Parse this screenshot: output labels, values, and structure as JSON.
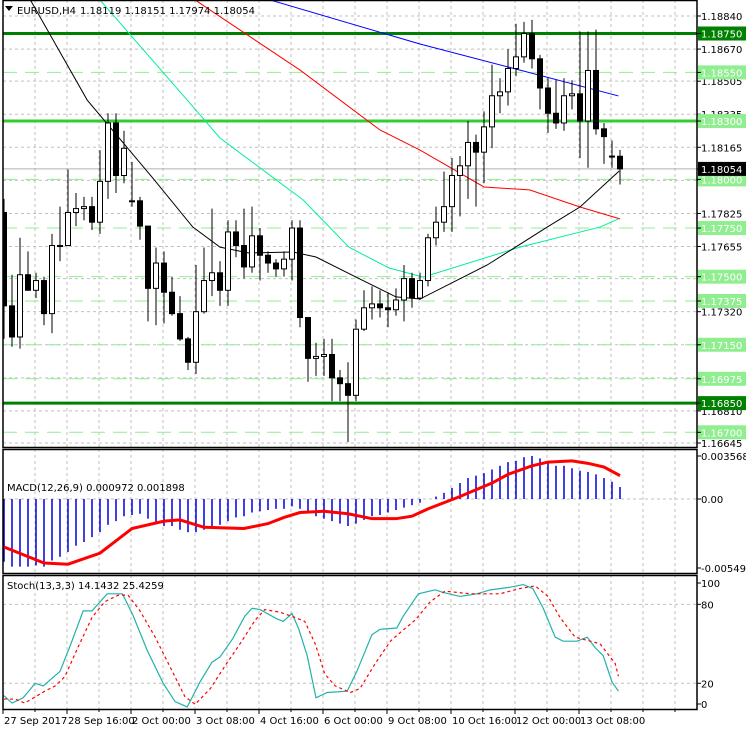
{
  "header": {
    "menu_icon": "triangle-down-icon",
    "symbol": "EURUSD,H4",
    "ohlc": "1.18119 1.18151 1.17974 1.18054"
  },
  "colors": {
    "bull": "#ffffff",
    "bear": "#000000",
    "ma_blue": "#0000ff",
    "ma_red": "#ff0000",
    "ma_cyan": "#00ee99",
    "ma_black": "#000000",
    "level_strong": "#008000",
    "level_mid": "#32cd32",
    "level_dashed": "#90ee90",
    "macd_hist": "#0000dd",
    "macd_signal": "#ff0000",
    "stoch_main": "#20b2aa",
    "stoch_signal": "#ff0000",
    "grid": "#c0c0c0"
  },
  "price_axis": {
    "ticks": [
      "1.18840",
      "1.18670",
      "1.18505",
      "1.18335",
      "1.18165",
      "1.17995",
      "1.17825",
      "1.17655",
      "1.17490",
      "1.17320",
      "1.17150",
      "1.16980",
      "1.16810",
      "1.16645"
    ],
    "visible_tick_labels": [
      "1.18840",
      "1.18670",
      "1.18505",
      "1.18165",
      "1.17825",
      "1.17655",
      "1.17320",
      "1.16810",
      "1.16645"
    ],
    "current_price": "1.18054"
  },
  "levels": [
    {
      "price": "1.18750",
      "style": "solid",
      "strength": "strong"
    },
    {
      "price": "1.18550",
      "style": "dashed"
    },
    {
      "price": "1.18300",
      "style": "solid",
      "strength": "mid"
    },
    {
      "price": "1.18000",
      "style": "dashed"
    },
    {
      "price": "1.17750",
      "style": "dashed"
    },
    {
      "price": "1.17500",
      "style": "dashed"
    },
    {
      "price": "1.17375",
      "style": "dashed"
    },
    {
      "price": "1.17150",
      "style": "dashed"
    },
    {
      "price": "1.16975",
      "style": "dashed"
    },
    {
      "price": "1.16850",
      "style": "solid",
      "strength": "strong"
    },
    {
      "price": "1.16700",
      "style": "dashed"
    }
  ],
  "candles": [
    [
      1.1783,
      1.179,
      1.1718,
      1.1735
    ],
    [
      1.1735,
      1.1751,
      1.1714,
      1.1719
    ],
    [
      1.1719,
      1.177,
      1.1713,
      1.1751
    ],
    [
      1.1751,
      1.1763,
      1.1743,
      1.1743
    ],
    [
      1.1743,
      1.1752,
      1.1739,
      1.1748
    ],
    [
      1.1748,
      1.175,
      1.1725,
      1.1731
    ],
    [
      1.1731,
      1.1772,
      1.1721,
      1.1766
    ],
    [
      1.1766,
      1.1786,
      1.1758,
      1.1766
    ],
    [
      1.1766,
      1.1805,
      1.1766,
      1.1783
    ],
    [
      1.1783,
      1.1793,
      1.1776,
      1.1785
    ],
    [
      1.1785,
      1.1791,
      1.1779,
      1.1786
    ],
    [
      1.1786,
      1.1791,
      1.1774,
      1.1778
    ],
    [
      1.1778,
      1.1815,
      1.1772,
      1.1799
    ],
    [
      1.1799,
      1.1834,
      1.179,
      1.1829
    ],
    [
      1.1829,
      1.1834,
      1.1793,
      1.1802
    ],
    [
      1.1802,
      1.1825,
      1.1798,
      1.1816
    ],
    [
      1.1789,
      1.1809,
      1.1786,
      1.1789
    ],
    [
      1.1789,
      1.1791,
      1.1769,
      1.1776
    ],
    [
      1.1776,
      1.1776,
      1.1727,
      1.1744
    ],
    [
      1.1744,
      1.1765,
      1.1725,
      1.1757
    ],
    [
      1.1757,
      1.1763,
      1.1726,
      1.1742
    ],
    [
      1.1742,
      1.175,
      1.173,
      1.1731
    ],
    [
      1.1731,
      1.174,
      1.1717,
      1.1718
    ],
    [
      1.1718,
      1.1719,
      1.1702,
      1.1706
    ],
    [
      1.1706,
      1.1756,
      1.17,
      1.1732
    ],
    [
      1.1732,
      1.1765,
      1.1731,
      1.1748
    ],
    [
      1.1748,
      1.1785,
      1.174,
      1.1752
    ],
    [
      1.1752,
      1.1758,
      1.1735,
      1.1743
    ],
    [
      1.1743,
      1.1779,
      1.1735,
      1.1773
    ],
    [
      1.1773,
      1.1779,
      1.176,
      1.1766
    ],
    [
      1.1766,
      1.1785,
      1.1749,
      1.1755
    ],
    [
      1.1755,
      1.1786,
      1.1752,
      1.1771
    ],
    [
      1.1771,
      1.1775,
      1.1748,
      1.1761
    ],
    [
      1.1761,
      1.1763,
      1.1752,
      1.1757
    ],
    [
      1.1757,
      1.1759,
      1.175,
      1.1754
    ],
    [
      1.1754,
      1.1763,
      1.175,
      1.1759
    ],
    [
      1.1759,
      1.1779,
      1.1748,
      1.1775
    ],
    [
      1.1775,
      1.1779,
      1.1724,
      1.1729
    ],
    [
      1.1729,
      1.1729,
      1.1696,
      1.1708
    ],
    [
      1.1708,
      1.1716,
      1.1699,
      1.1709
    ],
    [
      1.1709,
      1.1718,
      1.1699,
      1.171
    ],
    [
      1.171,
      1.1718,
      1.1686,
      1.1698
    ],
    [
      1.1698,
      1.1702,
      1.1686,
      1.1695
    ],
    [
      1.1695,
      1.1706,
      1.1665,
      1.1689
    ],
    [
      1.1689,
      1.1728,
      1.1686,
      1.1723
    ],
    [
      1.1723,
      1.1743,
      1.1722,
      1.1734
    ],
    [
      1.1734,
      1.1745,
      1.1728,
      1.1736
    ],
    [
      1.1736,
      1.1743,
      1.1729,
      1.1734
    ],
    [
      1.1734,
      1.1742,
      1.1724,
      1.1733
    ],
    [
      1.1733,
      1.1744,
      1.173,
      1.1738
    ],
    [
      1.1738,
      1.1756,
      1.1727,
      1.1749
    ],
    [
      1.1749,
      1.1752,
      1.1734,
      1.1739
    ],
    [
      1.1739,
      1.1752,
      1.1738,
      1.1748
    ],
    [
      1.1748,
      1.1772,
      1.1745,
      1.177
    ],
    [
      1.177,
      1.1786,
      1.1766,
      1.1778
    ],
    [
      1.1778,
      1.1804,
      1.1773,
      1.1786
    ],
    [
      1.1786,
      1.1811,
      1.1773,
      1.1802
    ],
    [
      1.1802,
      1.1812,
      1.1781,
      1.1807
    ],
    [
      1.1807,
      1.183,
      1.179,
      1.1819
    ],
    [
      1.1819,
      1.1823,
      1.1786,
      1.1814
    ],
    [
      1.1814,
      1.1835,
      1.1798,
      1.1827
    ],
    [
      1.1827,
      1.1859,
      1.1816,
      1.1843
    ],
    [
      1.1843,
      1.1852,
      1.1834,
      1.1845
    ],
    [
      1.1845,
      1.1867,
      1.1838,
      1.1857
    ],
    [
      1.1857,
      1.188,
      1.1853,
      1.1863
    ],
    [
      1.1863,
      1.1881,
      1.186,
      1.1875
    ],
    [
      1.1875,
      1.1882,
      1.1857,
      1.1862
    ],
    [
      1.1862,
      1.1864,
      1.1836,
      1.1847
    ],
    [
      1.1847,
      1.1852,
      1.1824,
      1.1834
    ],
    [
      1.1834,
      1.1851,
      1.1826,
      1.1829
    ],
    [
      1.1829,
      1.1852,
      1.1825,
      1.1843
    ],
    [
      1.1843,
      1.1851,
      1.1836,
      1.1844
    ],
    [
      1.1844,
      1.1876,
      1.1811,
      1.183
    ],
    [
      1.183,
      1.1876,
      1.1806,
      1.1856
    ],
    [
      1.1856,
      1.1877,
      1.1823,
      1.1826
    ],
    [
      1.1826,
      1.1829,
      1.1808,
      1.1822
    ],
    [
      1.1812,
      1.182,
      1.1806,
      1.1812
    ],
    [
      1.18119,
      1.18151,
      1.17974,
      1.18054
    ]
  ],
  "moving_averages": [
    {
      "name": "ma_blue",
      "points": [
        [
          33.3,
          1.18922
        ],
        [
          52,
          1.18696
        ],
        [
          64.5,
          1.18562
        ],
        [
          76.8,
          1.18429
        ]
      ]
    },
    {
      "name": "ma_red",
      "points": [
        [
          23.9,
          1.18922
        ],
        [
          37,
          1.18562
        ],
        [
          47,
          1.18254
        ],
        [
          52,
          1.18151
        ],
        [
          60,
          1.17961
        ],
        [
          65.7,
          1.17946
        ],
        [
          72,
          1.17858
        ],
        [
          77,
          1.17797
        ]
      ]
    },
    {
      "name": "ma_cyan",
      "points": [
        [
          12,
          1.18922
        ],
        [
          22.9,
          1.18408
        ],
        [
          27,
          1.18213
        ],
        [
          37.4,
          1.17894
        ],
        [
          43.1,
          1.17652
        ],
        [
          48.1,
          1.17545
        ],
        [
          52.4,
          1.17498
        ],
        [
          64.5,
          1.17652
        ],
        [
          74.5,
          1.17755
        ],
        [
          76.8,
          1.17797
        ]
      ]
    },
    {
      "name": "ma_black",
      "points": [
        [
          3.3,
          1.18922
        ],
        [
          10.4,
          1.18408
        ],
        [
          18.6,
          1.18007
        ],
        [
          23.6,
          1.17755
        ],
        [
          27,
          1.17652
        ],
        [
          30.6,
          1.17622
        ],
        [
          36.1,
          1.17627
        ],
        [
          39,
          1.17601
        ],
        [
          44,
          1.17498
        ],
        [
          49,
          1.17396
        ],
        [
          52,
          1.17385
        ],
        [
          60.4,
          1.1756
        ],
        [
          67.9,
          1.17755
        ],
        [
          72,
          1.17858
        ],
        [
          76.9,
          1.18043
        ]
      ]
    }
  ],
  "macd": {
    "label": "MACD(12,26,9) 0.000972 0.001898",
    "axis_labels": [
      "0.003568",
      "0.00",
      "-0.005495"
    ],
    "histogram": [
      -0.0051,
      -0.0055,
      -0.0055,
      -0.0055,
      -0.0054,
      -0.0055,
      -0.005,
      -0.0047,
      -0.0043,
      -0.0038,
      -0.0035,
      -0.0031,
      -0.0027,
      -0.0021,
      -0.0018,
      -0.0014,
      -0.0013,
      -0.0012,
      -0.0016,
      -0.0019,
      -0.0022,
      -0.0022,
      -0.0025,
      -0.0027,
      -0.0027,
      -0.0025,
      -0.0022,
      -0.0021,
      -0.0018,
      -0.0015,
      -0.0014,
      -0.0011,
      -0.001,
      -0.0009,
      -0.0008,
      -0.0008,
      -0.0006,
      -0.0008,
      -0.0011,
      -0.0014,
      -0.0016,
      -0.0018,
      -0.002,
      -0.0022,
      -0.002,
      -0.0017,
      -0.0014,
      -0.0013,
      -0.0011,
      -0.0009,
      -0.0007,
      -0.0005,
      -0.0003,
      0.0,
      0.0002,
      0.0005,
      0.0009,
      0.0013,
      0.0017,
      0.0019,
      0.0021,
      0.0024,
      0.0027,
      0.003,
      0.0031,
      0.0034,
      0.0035,
      0.0033,
      0.003,
      0.0027,
      0.0027,
      0.0025,
      0.0023,
      0.0022,
      0.002,
      0.0017,
      0.0014,
      0.000972
    ],
    "signal": [
      [
        0,
        -0.0039
      ],
      [
        5,
        -0.0052
      ],
      [
        8,
        -0.0053
      ],
      [
        12,
        -0.0044
      ],
      [
        16,
        -0.0024
      ],
      [
        20,
        -0.0018
      ],
      [
        22,
        -0.0017
      ],
      [
        25,
        -0.0023
      ],
      [
        30,
        -0.0024
      ],
      [
        33,
        -0.002
      ],
      [
        35,
        -0.0015
      ],
      [
        37,
        -0.0011
      ],
      [
        40,
        -0.001
      ],
      [
        43,
        -0.0012
      ],
      [
        46,
        -0.0016
      ],
      [
        49,
        -0.0016
      ],
      [
        51,
        -0.0014
      ],
      [
        53,
        -0.0008
      ],
      [
        57,
        0.0002
      ],
      [
        61,
        0.0013
      ],
      [
        63,
        0.002
      ],
      [
        66,
        0.0027
      ],
      [
        68,
        0.003
      ],
      [
        71,
        0.0031
      ],
      [
        73,
        0.0029
      ],
      [
        75,
        0.0026
      ],
      [
        77,
        0.0019
      ]
    ]
  },
  "stoch": {
    "label": "Stoch(13,3,3) 14.1432 25.4259",
    "axis_labels": [
      "100",
      "80",
      "20",
      "0"
    ],
    "main": [
      [
        0,
        10.6
      ],
      [
        1,
        5
      ],
      [
        2.4,
        9
      ],
      [
        3.9,
        20
      ],
      [
        4.9,
        18
      ],
      [
        7,
        29
      ],
      [
        8.3,
        49
      ],
      [
        9.9,
        75
      ],
      [
        11,
        75
      ],
      [
        12.9,
        88
      ],
      [
        14.8,
        88
      ],
      [
        16.1,
        72
      ],
      [
        17.9,
        45
      ],
      [
        19.9,
        20
      ],
      [
        21.4,
        6
      ],
      [
        22.9,
        2
      ],
      [
        24.5,
        21
      ],
      [
        26,
        36
      ],
      [
        27,
        40
      ],
      [
        28.6,
        54
      ],
      [
        30.1,
        71
      ],
      [
        31,
        77
      ],
      [
        32,
        76
      ],
      [
        34.1,
        69
      ],
      [
        34.9,
        67
      ],
      [
        36,
        73
      ],
      [
        36.8,
        62
      ],
      [
        37.9,
        41
      ],
      [
        39,
        9
      ],
      [
        40.4,
        13
      ],
      [
        42.9,
        14
      ],
      [
        44.1,
        29
      ],
      [
        46,
        57
      ],
      [
        47,
        61
      ],
      [
        49.1,
        62
      ],
      [
        49.9,
        71
      ],
      [
        51.8,
        88
      ],
      [
        53.9,
        91
      ],
      [
        54.9,
        89
      ],
      [
        57,
        86
      ],
      [
        59.1,
        88
      ],
      [
        60.8,
        91
      ],
      [
        63.3,
        93
      ],
      [
        64.9,
        95
      ],
      [
        66.1,
        92
      ],
      [
        67.4,
        77
      ],
      [
        68.9,
        55
      ],
      [
        69.9,
        52
      ],
      [
        71.6,
        52
      ],
      [
        72.9,
        55
      ],
      [
        73.9,
        47
      ],
      [
        74.9,
        41
      ],
      [
        76,
        21
      ],
      [
        76.8,
        14.1
      ]
    ],
    "signal": [
      [
        0,
        8
      ],
      [
        1.4,
        8
      ],
      [
        2.6,
        5
      ],
      [
        5.1,
        14
      ],
      [
        6.4,
        18
      ],
      [
        7.6,
        25
      ],
      [
        9.3,
        48
      ],
      [
        11,
        70
      ],
      [
        12.6,
        82
      ],
      [
        14.3,
        87
      ],
      [
        15.5,
        87
      ],
      [
        17,
        75
      ],
      [
        18.9,
        55
      ],
      [
        20.8,
        32
      ],
      [
        22.6,
        10
      ],
      [
        23.9,
        4
      ],
      [
        25.8,
        16
      ],
      [
        27.6,
        33
      ],
      [
        29.5,
        50
      ],
      [
        31.4,
        68
      ],
      [
        32.6,
        76
      ],
      [
        34.5,
        74
      ],
      [
        36.4,
        70
      ],
      [
        37.6,
        67
      ],
      [
        38.9,
        50
      ],
      [
        40.1,
        27
      ],
      [
        41.4,
        18
      ],
      [
        43.3,
        13
      ],
      [
        44.5,
        16
      ],
      [
        46.4,
        35
      ],
      [
        48.3,
        52
      ],
      [
        49.8,
        60
      ],
      [
        51.4,
        68
      ],
      [
        53.3,
        82
      ],
      [
        55.1,
        90
      ],
      [
        58.3,
        88
      ],
      [
        62,
        88
      ],
      [
        64.5,
        92
      ],
      [
        66.4,
        94
      ],
      [
        68,
        86
      ],
      [
        69.5,
        70
      ],
      [
        71.4,
        55
      ],
      [
        73.3,
        52
      ],
      [
        74.5,
        50
      ],
      [
        76.4,
        35
      ],
      [
        76.8,
        25.4
      ]
    ]
  },
  "time_axis": [
    {
      "bar": 0,
      "label": "27 Sep 2017"
    },
    {
      "bar": 8,
      "label": "28 Sep 16:00"
    },
    {
      "bar": 16,
      "label": "2 Oct 00:00"
    },
    {
      "bar": 24,
      "label": "3 Oct 08:00"
    },
    {
      "bar": 32,
      "label": "4 Oct 16:00"
    },
    {
      "bar": 40,
      "label": "6 Oct 00:00"
    },
    {
      "bar": 48,
      "label": "9 Oct 08:00"
    },
    {
      "bar": 56,
      "label": "10 Oct 16:00"
    },
    {
      "bar": 64,
      "label": "12 Oct 00:00"
    },
    {
      "bar": 72,
      "label": "13 Oct 08:00"
    }
  ]
}
